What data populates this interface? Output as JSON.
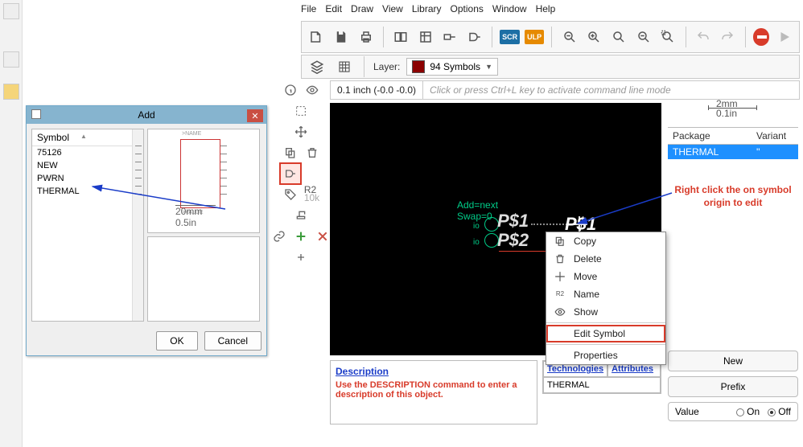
{
  "menu": {
    "file": "File",
    "edit": "Edit",
    "draw": "Draw",
    "view": "View",
    "library": "Library",
    "options": "Options",
    "window": "Window",
    "help": "Help"
  },
  "layer": {
    "label": "Layer:",
    "value": "94 Symbols"
  },
  "coord": {
    "text": "0.1 inch (-0.0 -0.0)",
    "cmd": "Click or press Ctrl+L key to activate command line mode"
  },
  "canvas": {
    "add": "Add=next",
    "swap": "Swap=0",
    "io": "io",
    "p1": "P$1",
    "p2": "P$2",
    "p1b": "P$1"
  },
  "context": {
    "copy": "Copy",
    "delete": "Delete",
    "move": "Move",
    "name": "Name",
    "show": "Show",
    "edit": "Edit Symbol",
    "props": "Properties"
  },
  "rpanel": {
    "ruler_mm": "2mm",
    "ruler_in": "0.1in",
    "col1": "Package",
    "col2": "Variant",
    "row_pkg": "THERMAL",
    "row_var": "''",
    "note": "Right click the on symbol origin to edit",
    "new": "New",
    "prefix": "Prefix",
    "value": "Value",
    "on": "On",
    "off": "Off"
  },
  "desc": {
    "h": "Description",
    "body": "Use the DESCRIPTION command to enter a description of this object."
  },
  "tech": {
    "h1": "Technologies",
    "h2": "Attributes",
    "row": "THERMAL"
  },
  "dlg": {
    "title": "Add",
    "col": "Symbol",
    "items": [
      "75126",
      "NEW",
      "PWRN",
      "THERMAL"
    ],
    "ruler_mm": "20mm",
    "ruler_in": "0.5in",
    "ok": "OK",
    "cancel": "Cancel",
    "chipname": ">NAME",
    "chipval": ">VALUE"
  },
  "toolbar": {
    "scr": "SCR",
    "ulp": "ULP"
  },
  "r2": {
    "a": "R2",
    "b": "10k"
  }
}
